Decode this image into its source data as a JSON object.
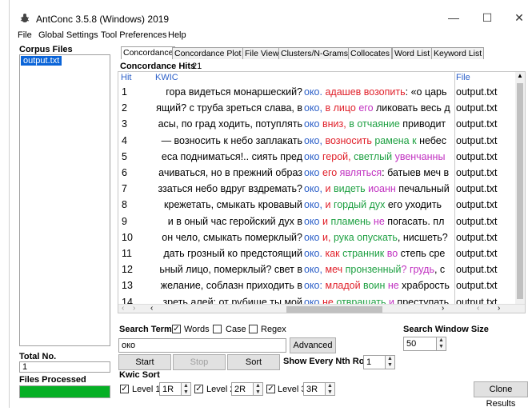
{
  "window": {
    "title": "AntConc 3.5.8 (Windows) 2019",
    "minimize": "—",
    "maximize": "☐",
    "close": "✕"
  },
  "menu": [
    "File",
    "Global Settings",
    "Tool Preferences",
    "Help"
  ],
  "left": {
    "corpus_label": "Corpus Files",
    "files": [
      "output.txt"
    ],
    "total_label": "Total No.",
    "total_value": "1",
    "processed_label": "Files Processed",
    "progress": 1.0
  },
  "tabs": [
    "Concordance",
    "Concordance Plot",
    "File View",
    "Clusters/N-Grams",
    "Collocates",
    "Word List",
    "Keyword List"
  ],
  "concordance": {
    "hits_label": "Concordance Hits",
    "hits_count": "21",
    "col_hit": "Hit",
    "col_kwic": "KWIC",
    "col_file": "File",
    "rows": [
      {
        "hit": "1",
        "left": "гора видеться монаршеский?",
        "kw": "око.",
        "right": [
          [
            "адашев возопить",
            "c-red"
          ],
          [
            ": «о царь",
            ""
          ]
        ],
        "file": "output.txt"
      },
      {
        "hit": "2",
        "left": "ящий? с труба зреться слава, в",
        "kw": "око,",
        "right": [
          [
            "в лицо",
            "c-red"
          ],
          [
            " его",
            "c-mag"
          ],
          [
            " ликовать весь д",
            ""
          ]
        ],
        "file": "output.txt"
      },
      {
        "hit": "3",
        "left": "асы, по град ходить, потуплять",
        "kw": "око",
        "right": [
          [
            "вниз,",
            "c-red"
          ],
          [
            " в отчаяние",
            "c-green"
          ],
          [
            " приводит",
            ""
          ]
        ],
        "file": "output.txt"
      },
      {
        "hit": "4",
        "left": "— возносить к небо заплакать",
        "kw": "око,",
        "right": [
          [
            "возносить",
            "c-red"
          ],
          [
            " рамена к",
            "c-green"
          ],
          [
            " небес",
            ""
          ]
        ],
        "file": "output.txt"
      },
      {
        "hit": "5",
        "left": "еса подниматься!.. сиять пред",
        "kw": "око",
        "right": [
          [
            "герой,",
            "c-red"
          ],
          [
            " светлый",
            "c-green"
          ],
          [
            " увенчанны",
            "c-mag"
          ]
        ],
        "file": "output.txt"
      },
      {
        "hit": "6",
        "left": "ачиваться, но в прежний образ",
        "kw": "око",
        "right": [
          [
            "его",
            "c-red"
          ],
          [
            " являться",
            "c-mag"
          ],
          [
            ": батыев меч в",
            ""
          ]
        ],
        "file": "output.txt"
      },
      {
        "hit": "7",
        "left": "ззаться небо вдруг вздремать?",
        "kw": "око,",
        "right": [
          [
            "и",
            "c-red"
          ],
          [
            " видеть",
            "c-green"
          ],
          [
            " иоанн",
            "c-mag"
          ],
          [
            " печальный",
            ""
          ]
        ],
        "file": "output.txt"
      },
      {
        "hit": "8",
        "left": "крежетать, смыкать кровавый",
        "kw": "око,",
        "right": [
          [
            "и",
            "c-red"
          ],
          [
            " гордый дух",
            "c-green"
          ],
          [
            " его уходить",
            ""
          ]
        ],
        "file": "output.txt"
      },
      {
        "hit": "9",
        "left": "и в оный час геройский дух в",
        "kw": "око",
        "right": [
          [
            "и",
            "c-red"
          ],
          [
            " пламень",
            "c-green"
          ],
          [
            " не",
            "c-mag"
          ],
          [
            " погасать.  пл",
            ""
          ]
        ],
        "file": "output.txt"
      },
      {
        "hit": "10",
        "left": "он чело, смыкать померклый?",
        "kw": "око",
        "right": [
          [
            "и,",
            "c-red"
          ],
          [
            " рука опускать",
            "c-green"
          ],
          [
            ", нисшеть?",
            ""
          ]
        ],
        "file": "output.txt"
      },
      {
        "hit": "11",
        "left": "дать грозный ко предстоящий",
        "kw": "око.",
        "right": [
          [
            "как",
            "c-red"
          ],
          [
            " странник",
            "c-green"
          ],
          [
            " во",
            "c-mag"
          ],
          [
            " степь сре",
            ""
          ]
        ],
        "file": "output.txt"
      },
      {
        "hit": "12",
        "left": "ьный лицо, померклый? свет в",
        "kw": "око,",
        "right": [
          [
            "меч",
            "c-red"
          ],
          [
            " пронзенный",
            "c-green"
          ],
          [
            "? грудь",
            "c-mag"
          ],
          [
            ", с",
            ""
          ]
        ],
        "file": "output.txt"
      },
      {
        "hit": "13",
        "left": "желание, соблазн приходить в",
        "kw": "око:",
        "right": [
          [
            "младой",
            "c-red"
          ],
          [
            " воин",
            "c-green"
          ],
          [
            " не",
            "c-mag"
          ],
          [
            " храбрость",
            ""
          ]
        ],
        "file": "output.txt"
      },
      {
        "hit": "14",
        "left": "зреть алей; от рубище ты мой",
        "kw": "око",
        "right": [
          [
            "не",
            "c-red"
          ],
          [
            " отвращать",
            "c-green"
          ],
          [
            " и",
            "c-mag"
          ],
          [
            " преступать",
            ""
          ]
        ],
        "file": "output.txt"
      }
    ]
  },
  "search": {
    "term_label": "Search Term",
    "words_label": "Words",
    "words_checked": true,
    "case_label": "Case",
    "case_checked": false,
    "regex_label": "Regex",
    "regex_checked": false,
    "term_value": "око",
    "advanced_label": "Advanced",
    "window_size_label": "Search Window Size",
    "window_size_value": "50"
  },
  "actions": {
    "start": "Start",
    "stop": "Stop",
    "sort": "Sort",
    "nth_row_label": "Show Every Nth Row",
    "nth_row_value": "1",
    "clone": "Clone Results"
  },
  "kwic_sort": {
    "label": "Kwic Sort",
    "levels": [
      {
        "label": "Level 1",
        "value": "1R",
        "checked": true
      },
      {
        "label": "Level 2",
        "value": "2R",
        "checked": true
      },
      {
        "label": "Level 3",
        "value": "3R",
        "checked": true
      }
    ]
  },
  "colors": {
    "selection": "#0a64d8",
    "keyword": "#2d60c8",
    "collocate_red": "#e0202a",
    "collocate_green": "#1ea042",
    "collocate_magenta": "#c030c0",
    "progress": "#06b025"
  }
}
